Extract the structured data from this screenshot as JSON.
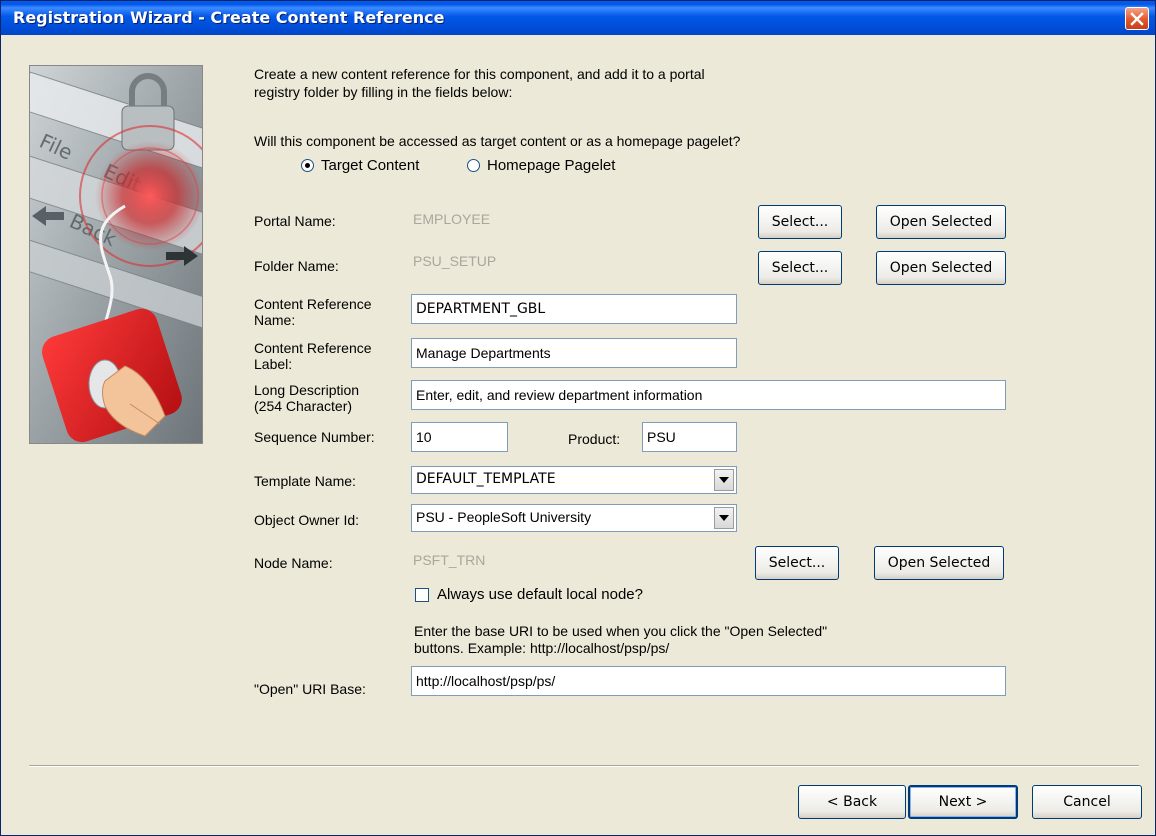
{
  "window": {
    "title": "Registration Wizard - Create Content Reference"
  },
  "intro": {
    "line1": "Create a new content reference for this component, and add it to a portal",
    "line2": "registry folder by filling in the fields below:",
    "question": "Will this component be accessed as target content or as a homepage pagelet?"
  },
  "access_type": {
    "selected": "Target Content",
    "options": [
      "Target Content",
      "Homepage Pagelet"
    ]
  },
  "fields": {
    "portal_name": {
      "label": "Portal Name:",
      "value": "EMPLOYEE"
    },
    "folder_name": {
      "label": "Folder Name:",
      "value": "PSU_SETUP"
    },
    "content_reference_name": {
      "label_line1": "Content Reference",
      "label_line2": "Name:",
      "value": "DEPARTMENT_GBL"
    },
    "content_reference_label": {
      "label_line1": "Content Reference",
      "label_line2": "Label:",
      "value": "Manage Departments"
    },
    "long_description": {
      "label_line1": "Long Description",
      "label_line2": "(254 Character)",
      "value": "Enter, edit, and review department information"
    },
    "sequence_number": {
      "label": "Sequence Number:",
      "value": "10"
    },
    "product": {
      "label": "Product:",
      "value": "PSU"
    },
    "template_name": {
      "label": "Template Name:",
      "value": "DEFAULT_TEMPLATE"
    },
    "object_owner_id": {
      "label": "Object Owner Id:",
      "value": "PSU - PeopleSoft University"
    },
    "node_name": {
      "label": "Node Name:",
      "value": "PSFT_TRN"
    },
    "default_local_node": {
      "label": "Always use default local node?",
      "checked": false
    },
    "uri_hint_line1": "Enter the base URI to be used when you click the \"Open Selected\"",
    "uri_hint_line2": "buttons.  Example:  http://localhost/psp/ps/",
    "open_uri_base": {
      "label": "\"Open\" URI Base:",
      "value": "http://localhost/psp/ps/"
    }
  },
  "buttons": {
    "select": "Select...",
    "open_selected": "Open Selected",
    "back": "< Back",
    "next": "Next >",
    "cancel": "Cancel"
  },
  "icons": {
    "close": "close-icon",
    "dropdown": "chevron-down-icon",
    "illustration": "wizard-illustration"
  },
  "colors": {
    "titlebar": "#0058ee",
    "close_button": "#e4572a",
    "dialog_bg": "#ece9d8",
    "disabled_text": "#a9a79c"
  }
}
